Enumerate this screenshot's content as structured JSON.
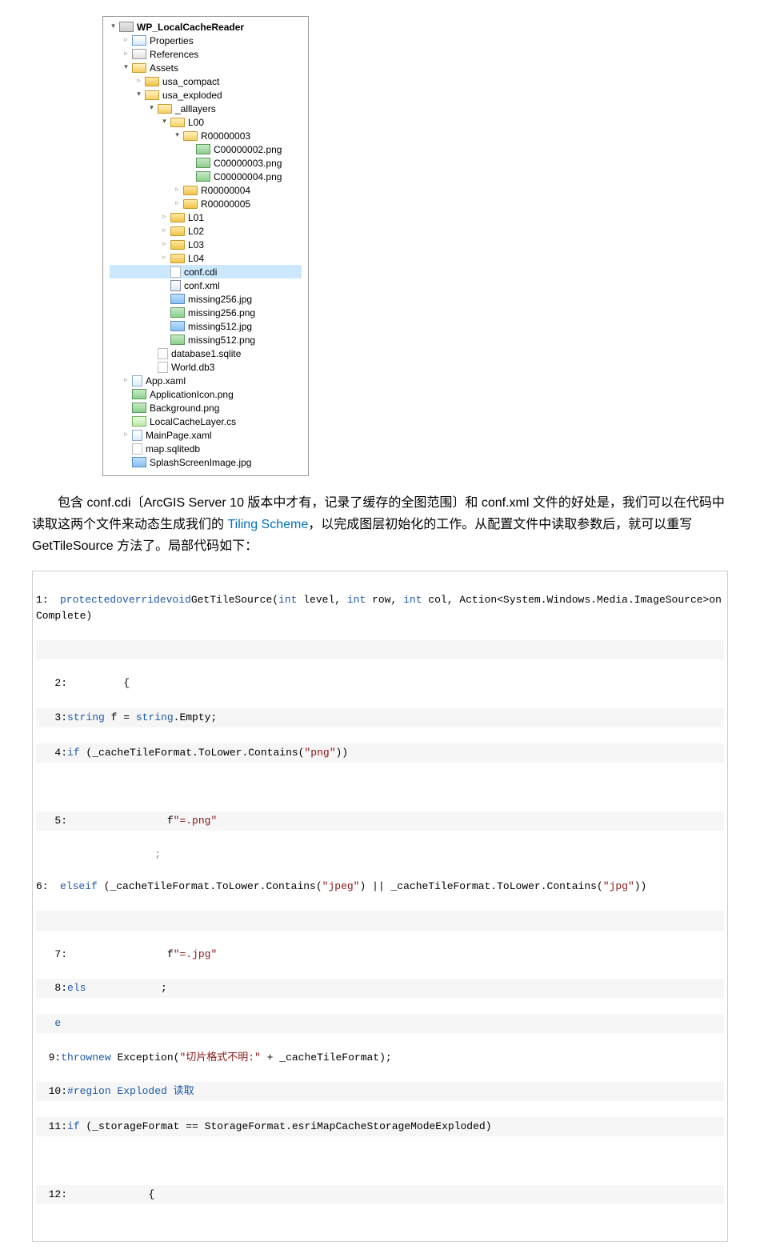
{
  "tree": {
    "root": "WP_LocalCacheReader",
    "properties": "Properties",
    "references": "References",
    "assets": "Assets",
    "usa_compact": "usa_compact",
    "usa_exploded": "usa_exploded",
    "alllayers": "_alllayers",
    "l00": "L00",
    "r00000003": "R00000003",
    "c2": "C00000002.png",
    "c3": "C00000003.png",
    "c4": "C00000004.png",
    "r00000004": "R00000004",
    "r00000005": "R00000005",
    "l01": "L01",
    "l02": "L02",
    "l03": "L03",
    "l04": "L04",
    "confcdi": "conf.cdi",
    "confxml": "conf.xml",
    "m256j": "missing256.jpg",
    "m256p": "missing256.png",
    "m512j": "missing512.jpg",
    "m512p": "missing512.png",
    "db1": "database1.sqlite",
    "world": "World.db3",
    "appxaml": "App.xaml",
    "appicon": "ApplicationIcon.png",
    "bg": "Background.png",
    "lcl": "LocalCacheLayer.cs",
    "mainpage": "MainPage.xaml",
    "mapdb": "map.sqlitedb",
    "splash": "SplashScreenImage.jpg"
  },
  "para": {
    "p1a": "包含 conf.cdi〔ArcGIS Server 10 版本中才有，记录了缓存的全图范围〕和 conf.xml 文件的好处是，我们可以在代码中读取这两个文件来动态生成我们的 ",
    "link": "Tiling Scheme",
    "p1b": "，以完成图层初始化的工作。从配置文件中读取参数后，就可以重写 GetTileSource 方法了。局部代码如下："
  },
  "code": {
    "l1": {
      "n": "1:",
      "a": "protectedoverridevoid",
      "b": "GetTileSource(",
      "c": "int",
      "d": " level, ",
      "e": "int",
      "f": " row, ",
      "g": "int",
      "h": " col, Action<System.Windows.Media.ImageSource>onComplete)"
    },
    "l2": {
      "n": "   2:",
      "a": "{"
    },
    "l3": {
      "n": "   3:",
      "a": "string",
      "b": " f = ",
      "c": "string",
      "d": ".Empty;"
    },
    "l4": {
      "n": "   4:",
      "a": "if",
      "b": " (_cacheTileFormat.ToLower.Contains(",
      "c": "\"png\"",
      "d": "))"
    },
    "l5": {
      "n": "   5:",
      "a": "f",
      "b": "\"=.png\""
    },
    "l6": {
      "n": "6:",
      "a": "elseif",
      "b": " (_cacheTileFormat.ToLower.Contains(",
      "c": "\"jpeg\"",
      "d": ") || _cacheTileFormat.ToLower.Contains(",
      "e": "\"jpg\"",
      "f": "))"
    },
    "l7": {
      "n": "   7:",
      "a": "f",
      "b": "\"=.jpg\""
    },
    "l8": {
      "n": "   8:",
      "a": "els",
      "b": ";"
    },
    "l8b": {
      "n": "",
      "a": "e"
    },
    "l9": {
      "n": "  9:",
      "a": "thrownew",
      "b": " Exception(",
      "c": "\"切片格式不明:\"",
      "d": " + _cacheTileFormat);"
    },
    "l10": {
      "n": "  10:",
      "a": "#region Exploded 读取"
    },
    "l11": {
      "n": "  11:",
      "a": "if",
      "b": " (_storageFormat == StorageFormat.esriMapCacheStorageModeExploded)"
    },
    "l12": {
      "n": "  12:",
      "a": "{"
    }
  }
}
